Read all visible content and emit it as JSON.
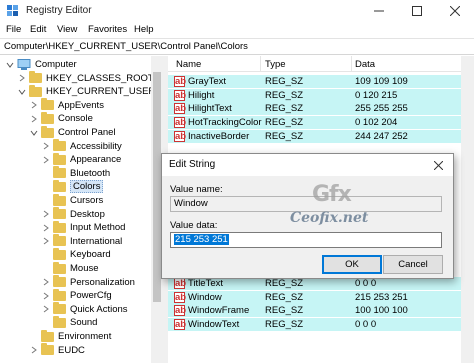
{
  "window": {
    "title": "Registry Editor"
  },
  "menu": [
    "File",
    "Edit",
    "View",
    "Favorites",
    "Help"
  ],
  "address": "Computer\\HKEY_CURRENT_USER\\Control Panel\\Colors",
  "tree": {
    "items": [
      {
        "label": "Computer",
        "level": 0,
        "type": "computer",
        "expanded": true
      },
      {
        "label": "HKEY_CLASSES_ROOT",
        "level": 1,
        "type": "folder",
        "expanded": false
      },
      {
        "label": "HKEY_CURRENT_USER",
        "level": 1,
        "type": "folder",
        "expanded": true
      },
      {
        "label": "AppEvents",
        "level": 2,
        "type": "folder",
        "expanded": false
      },
      {
        "label": "Console",
        "level": 2,
        "type": "folder",
        "expanded": false
      },
      {
        "label": "Control Panel",
        "level": 2,
        "type": "folder",
        "expanded": true
      },
      {
        "label": "Accessibility",
        "level": 3,
        "type": "folder",
        "expanded": false
      },
      {
        "label": "Appearance",
        "level": 3,
        "type": "folder",
        "expanded": false
      },
      {
        "label": "Bluetooth",
        "level": 3,
        "type": "folder",
        "expanded": null
      },
      {
        "label": "Colors",
        "level": 3,
        "type": "folder",
        "expanded": null,
        "selected": true
      },
      {
        "label": "Cursors",
        "level": 3,
        "type": "folder",
        "expanded": null
      },
      {
        "label": "Desktop",
        "level": 3,
        "type": "folder",
        "expanded": false
      },
      {
        "label": "Input Method",
        "level": 3,
        "type": "folder",
        "expanded": false
      },
      {
        "label": "International",
        "level": 3,
        "type": "folder",
        "expanded": false
      },
      {
        "label": "Keyboard",
        "level": 3,
        "type": "folder",
        "expanded": null
      },
      {
        "label": "Mouse",
        "level": 3,
        "type": "folder",
        "expanded": null
      },
      {
        "label": "Personalization",
        "level": 3,
        "type": "folder",
        "expanded": false
      },
      {
        "label": "PowerCfg",
        "level": 3,
        "type": "folder",
        "expanded": false
      },
      {
        "label": "Quick Actions",
        "level": 3,
        "type": "folder",
        "expanded": false
      },
      {
        "label": "Sound",
        "level": 3,
        "type": "folder",
        "expanded": null
      },
      {
        "label": "Environment",
        "level": 2,
        "type": "folder",
        "expanded": null
      },
      {
        "label": "EUDC",
        "level": 2,
        "type": "folder",
        "expanded": false
      }
    ]
  },
  "list": {
    "columns": [
      "Name",
      "Type",
      "Data"
    ],
    "rows_top": [
      {
        "name": "GrayText",
        "type": "REG_SZ",
        "data": "109 109 109"
      },
      {
        "name": "Hilight",
        "type": "REG_SZ",
        "data": "0 120 215"
      },
      {
        "name": "HilightText",
        "type": "REG_SZ",
        "data": "255 255 255"
      },
      {
        "name": "HotTrackingColor",
        "type": "REG_SZ",
        "data": "0 102 204"
      },
      {
        "name": "InactiveBorder",
        "type": "REG_SZ",
        "data": "244 247 252"
      }
    ],
    "rows_bottom": [
      {
        "name": "TitleText",
        "type": "REG_SZ",
        "data": "0 0 0"
      },
      {
        "name": "Window",
        "type": "REG_SZ",
        "data": "215 253 251"
      },
      {
        "name": "WindowFrame",
        "type": "REG_SZ",
        "data": "100 100 100"
      },
      {
        "name": "WindowText",
        "type": "REG_SZ",
        "data": "0 0 0"
      }
    ]
  },
  "dialog": {
    "title": "Edit String",
    "value_name_label": "Value name:",
    "value_name": "Window",
    "value_data_label": "Value data:",
    "value_data": "215 253 251",
    "ok_label": "OK",
    "cancel_label": "Cancel"
  },
  "watermark": {
    "logo": "Gfx",
    "site": "Ceofix.net"
  },
  "colors": {
    "row_highlight": "#c6f5f5",
    "selection": "#0078d7",
    "folder": "#e8c353"
  }
}
